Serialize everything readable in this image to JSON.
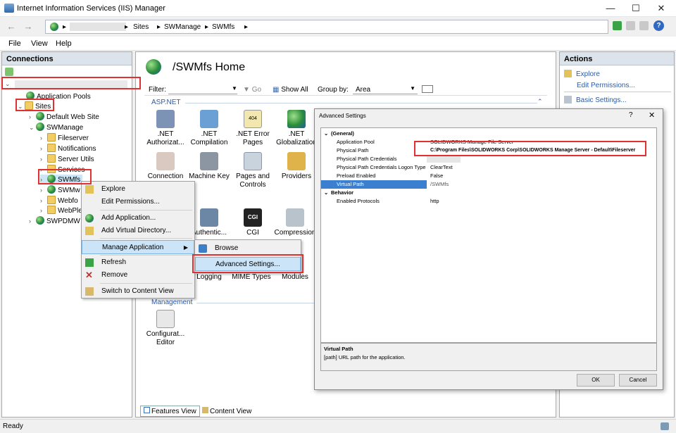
{
  "window": {
    "title": "Internet Information Services (IIS) Manager"
  },
  "address": {
    "crumbs": [
      "Sites",
      "SWManage",
      "SWMfs"
    ]
  },
  "menu": [
    "File",
    "View",
    "Help"
  ],
  "connections": {
    "header": "Connections",
    "tree": {
      "app_pools": "Application Pools",
      "sites": "Sites",
      "default_site": "Default Web Site",
      "swmanage": "SWManage",
      "fileserver": "Fileserver",
      "notifications": "Notifications",
      "server_utils": "Server Utils",
      "services": "Services",
      "swmfs": "SWMfs",
      "swmw": "SWMw",
      "webfo": "Webfo",
      "webple": "WebPle",
      "swpdm": "SWPDMW"
    }
  },
  "center": {
    "title": "/SWMfs Home",
    "filter_label": "Filter:",
    "go_label": "Go",
    "show_all_label": "Show All",
    "groupby_label": "Group by:",
    "groupby_value": "Area",
    "group_aspnet": "ASP.NET",
    "group_management": "Management",
    "features": {
      "f1": ".NET Authorizat...",
      "f2": ".NET Compilation",
      "f3": ".NET Error Pages",
      "f4": ".NET Globalization",
      "f5": "Connection",
      "f6": "Machine Key",
      "f7": "Pages and Controls",
      "f8": "Providers",
      "f9": "Authentic...",
      "f10": "CGI",
      "f11": "Compression",
      "f12": "Logging",
      "f13": "MIME Types",
      "f14": "Modules",
      "f15": "Configurat... Editor"
    },
    "tab_features": "Features View",
    "tab_content": "Content View"
  },
  "actions": {
    "header": "Actions",
    "explore": "Explore",
    "edit_permissions": "Edit Permissions...",
    "basic_settings": "Basic Settings..."
  },
  "context_menu": {
    "explore": "Explore",
    "edit_permissions": "Edit Permissions...",
    "add_application": "Add Application...",
    "add_virtual_directory": "Add Virtual Directory...",
    "manage_application": "Manage Application",
    "refresh": "Refresh",
    "remove": "Remove",
    "switch_content": "Switch to Content View"
  },
  "submenu": {
    "browse": "Browse",
    "advanced_settings": "Advanced Settings..."
  },
  "dialog": {
    "title": "Advanced Settings",
    "help": "?",
    "section_general": "(General)",
    "section_behavior": "Behavior",
    "rows": {
      "app_pool_k": "Application Pool",
      "app_pool_v": "SOLIDWORKS Manage File Server",
      "phys_path_k": "Physical Path",
      "phys_path_v": "C:\\Program Files\\SOLIDWORKS Corp\\SOLIDWORKS Manage Server - Default\\Fileserver",
      "ppc_k": "Physical Path Credentials",
      "ppclt_k": "Physical Path Credentials Logon Type",
      "ppclt_v": "ClearText",
      "preload_k": "Preload Enabled",
      "preload_v": "False",
      "vpath_k": "Virtual Path",
      "vpath_v": "/SWMfs",
      "protocols_k": "Enabled Protocols",
      "protocols_v": "http"
    },
    "desc_title": "Virtual Path",
    "desc_text": "[path] URL path for the application.",
    "ok": "OK",
    "cancel": "Cancel"
  },
  "status": {
    "text": "Ready"
  }
}
